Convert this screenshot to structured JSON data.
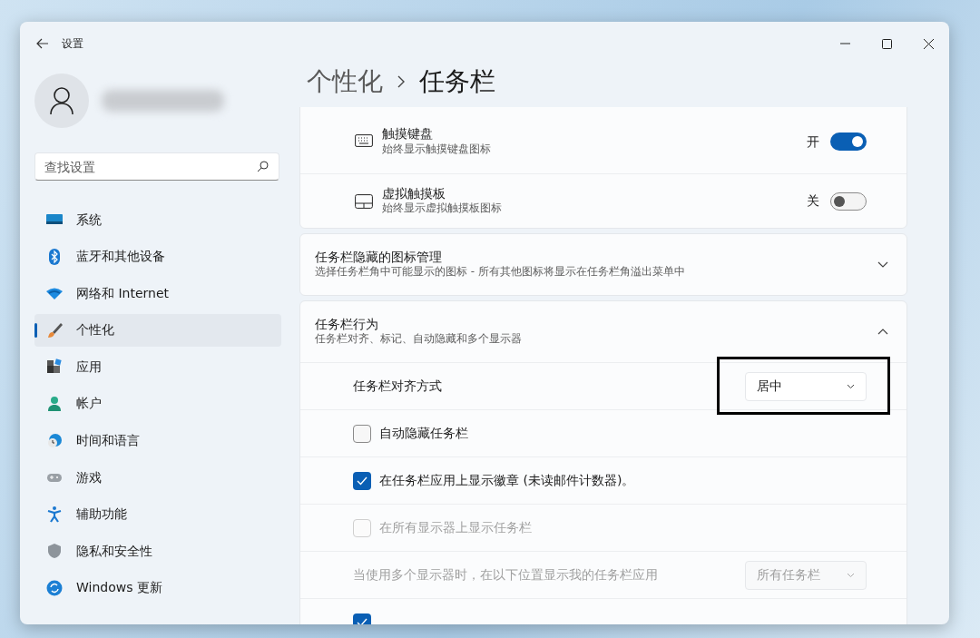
{
  "window": {
    "title": "设置"
  },
  "sidebar": {
    "search": {
      "placeholder": "查找设置"
    },
    "items": [
      {
        "label": "系统",
        "selected": false
      },
      {
        "label": "蓝牙和其他设备",
        "selected": false
      },
      {
        "label": "网络和 Internet",
        "selected": false
      },
      {
        "label": "个性化",
        "selected": true
      },
      {
        "label": "应用",
        "selected": false
      },
      {
        "label": "帐户",
        "selected": false
      },
      {
        "label": "时间和语言",
        "selected": false
      },
      {
        "label": "游戏",
        "selected": false
      },
      {
        "label": "辅助功能",
        "selected": false
      },
      {
        "label": "隐私和安全性",
        "selected": false
      },
      {
        "label": "Windows 更新",
        "selected": false
      }
    ]
  },
  "breadcrumb": {
    "parent": "个性化",
    "current": "任务栏"
  },
  "sections": [
    {
      "kind": "toggles",
      "items": [
        {
          "title": "触摸键盘",
          "subtitle": "始终显示触摸键盘图标",
          "state_label": "开",
          "on": true
        },
        {
          "title": "虚拟触摸板",
          "subtitle": "始终显示虚拟触摸板图标",
          "state_label": "关",
          "on": false
        }
      ]
    },
    {
      "kind": "expander",
      "title": "任务栏隐藏的图标管理",
      "subtitle": "选择任务栏角中可能显示的图标 - 所有其他图标将显示在任务栏角溢出菜单中",
      "expanded": false
    },
    {
      "kind": "expander",
      "title": "任务栏行为",
      "subtitle": "任务栏对齐、标记、自动隐藏和多个显示器",
      "expanded": true,
      "rows": [
        {
          "kind": "dropdown",
          "label": "任务栏对齐方式",
          "value": "居中",
          "disabled": false,
          "highlighted": true
        },
        {
          "kind": "checkbox",
          "label": "自动隐藏任务栏",
          "checked": false,
          "disabled": false
        },
        {
          "kind": "checkbox",
          "label": "在任务栏应用上显示徽章 (未读邮件计数器)。",
          "checked": true,
          "disabled": false
        },
        {
          "kind": "checkbox",
          "label": "在所有显示器上显示任务栏",
          "checked": false,
          "disabled": true
        },
        {
          "kind": "dropdown",
          "label": "当使用多个显示器时，在以下位置显示我的任务栏应用",
          "value": "所有任务栏",
          "disabled": true
        },
        {
          "kind": "checkbox",
          "checked": true,
          "disabled": false
        }
      ]
    }
  ]
}
